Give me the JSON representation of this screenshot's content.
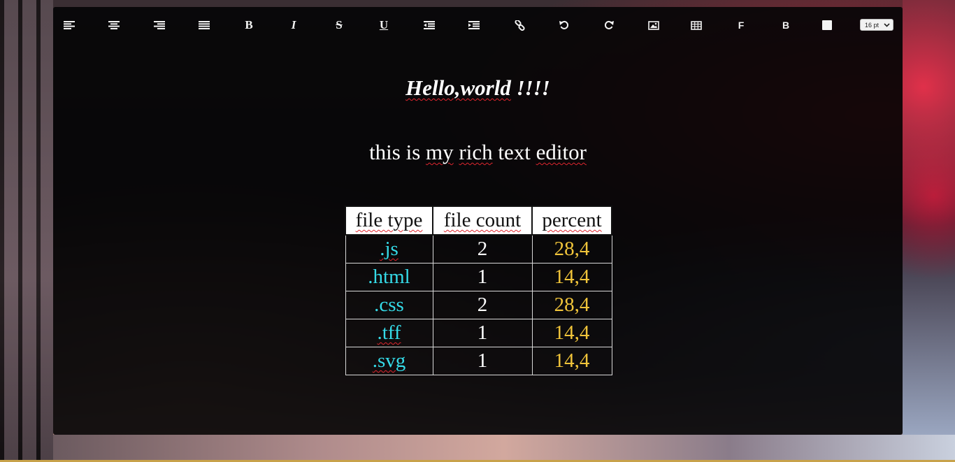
{
  "toolbar": {
    "buttons": [
      {
        "id": "align-left",
        "icon": "align-left-icon"
      },
      {
        "id": "align-center",
        "icon": "align-center-icon"
      },
      {
        "id": "align-right",
        "icon": "align-right-icon"
      },
      {
        "id": "align-justify",
        "icon": "align-justify-icon"
      },
      {
        "id": "bold",
        "label": "B"
      },
      {
        "id": "italic",
        "label": "I"
      },
      {
        "id": "strikethrough",
        "label": "S"
      },
      {
        "id": "underline",
        "label": "U"
      },
      {
        "id": "outdent",
        "icon": "outdent-icon"
      },
      {
        "id": "indent",
        "icon": "indent-icon"
      },
      {
        "id": "link",
        "icon": "link-icon"
      },
      {
        "id": "undo",
        "icon": "undo-icon"
      },
      {
        "id": "redo",
        "icon": "redo-icon"
      },
      {
        "id": "image",
        "icon": "image-icon"
      },
      {
        "id": "table",
        "icon": "table-icon"
      },
      {
        "id": "font-color",
        "label": "F"
      },
      {
        "id": "background-color",
        "label": "B"
      },
      {
        "id": "color-picker",
        "color": "#f4f4f4"
      }
    ],
    "font_size": "16 pt"
  },
  "document": {
    "heading": "Hello,world !!!!",
    "heading_words": [
      "Hello,world",
      " !!!!"
    ],
    "paragraph_words": [
      "this",
      " is ",
      "my",
      " ",
      "rich",
      " text ",
      "editor"
    ],
    "table": {
      "headers": [
        "file type",
        "file count",
        "percent"
      ],
      "rows": [
        [
          ".js",
          "2",
          "28,4"
        ],
        [
          ".html",
          "1",
          "14,4"
        ],
        [
          ".css",
          "2",
          "28,4"
        ],
        [
          ".tff",
          "1",
          "14,4"
        ],
        [
          ".svg",
          "1",
          "14,4"
        ]
      ]
    }
  },
  "colors": {
    "file_type": "#35dbe8",
    "percent": "#f0c43a",
    "count": "#ffffff",
    "spell_underline": "#e0262e"
  }
}
